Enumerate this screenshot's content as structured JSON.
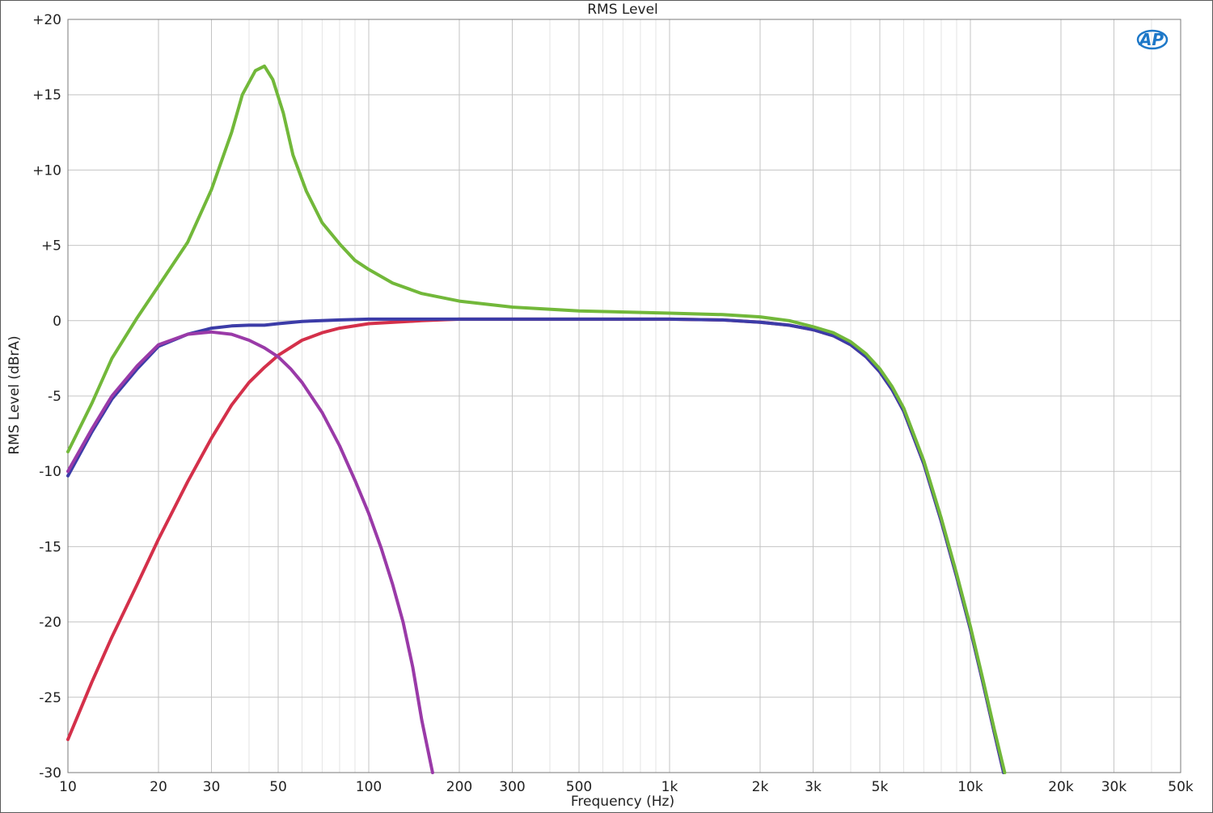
{
  "chart_data": {
    "type": "line",
    "title": "RMS Level",
    "xlabel": "Frequency (Hz)",
    "ylabel": "RMS Level (dBrA)",
    "x_scale": "log",
    "xlim": [
      10,
      50000
    ],
    "ylim": [
      -30,
      20
    ],
    "grid": true,
    "x_tick_values": [
      10,
      20,
      30,
      50,
      100,
      200,
      300,
      500,
      1000,
      2000,
      3000,
      5000,
      10000,
      20000,
      30000,
      50000
    ],
    "x_tick_labels": [
      "10",
      "20",
      "30",
      "50",
      "100",
      "200",
      "300",
      "500",
      "1k",
      "2k",
      "3k",
      "5k",
      "10k",
      "20k",
      "30k",
      "50k"
    ],
    "y_tick_values": [
      20,
      15,
      10,
      5,
      0,
      -5,
      -10,
      -15,
      -20,
      -25,
      -30
    ],
    "y_tick_labels": [
      "+20",
      "+15",
      "+10",
      "+5",
      "0",
      "-5",
      "-10",
      "-15",
      "-20",
      "-25",
      "-30"
    ],
    "logo_text": "AP",
    "series": [
      {
        "color": "#d4304a",
        "points": [
          [
            10,
            -27.8
          ],
          [
            12,
            -24.0
          ],
          [
            14,
            -21.0
          ],
          [
            17,
            -17.5
          ],
          [
            20,
            -14.5
          ],
          [
            25,
            -10.7
          ],
          [
            30,
            -7.8
          ],
          [
            35,
            -5.6
          ],
          [
            40,
            -4.1
          ],
          [
            45,
            -3.1
          ],
          [
            50,
            -2.3
          ],
          [
            60,
            -1.3
          ],
          [
            70,
            -0.8
          ],
          [
            80,
            -0.5
          ],
          [
            100,
            -0.2
          ],
          [
            150,
            0.0
          ],
          [
            200,
            0.1
          ],
          [
            500,
            0.1
          ],
          [
            1000,
            0.1
          ],
          [
            1500,
            0.05
          ],
          [
            2000,
            -0.1
          ],
          [
            2500,
            -0.3
          ],
          [
            3000,
            -0.6
          ],
          [
            3500,
            -1.0
          ],
          [
            4000,
            -1.6
          ],
          [
            4500,
            -2.4
          ],
          [
            5000,
            -3.4
          ],
          [
            5500,
            -4.6
          ],
          [
            6000,
            -6.0
          ],
          [
            7000,
            -9.5
          ],
          [
            8000,
            -13.3
          ],
          [
            9000,
            -17.0
          ],
          [
            10000,
            -20.5
          ],
          [
            11000,
            -24.0
          ],
          [
            12000,
            -27.3
          ],
          [
            12900,
            -30.0
          ]
        ]
      },
      {
        "color": "#3c3ca8",
        "points": [
          [
            10,
            -10.3
          ],
          [
            12,
            -7.4
          ],
          [
            14,
            -5.2
          ],
          [
            17,
            -3.2
          ],
          [
            20,
            -1.7
          ],
          [
            25,
            -0.9
          ],
          [
            30,
            -0.5
          ],
          [
            35,
            -0.35
          ],
          [
            40,
            -0.3
          ],
          [
            45,
            -0.3
          ],
          [
            50,
            -0.2
          ],
          [
            60,
            -0.05
          ],
          [
            80,
            0.05
          ],
          [
            100,
            0.1
          ],
          [
            200,
            0.1
          ],
          [
            500,
            0.1
          ],
          [
            1000,
            0.1
          ],
          [
            1500,
            0.05
          ],
          [
            2000,
            -0.1
          ],
          [
            2500,
            -0.3
          ],
          [
            3000,
            -0.6
          ],
          [
            3500,
            -1.0
          ],
          [
            4000,
            -1.6
          ],
          [
            4500,
            -2.4
          ],
          [
            5000,
            -3.4
          ],
          [
            5500,
            -4.6
          ],
          [
            6000,
            -6.0
          ],
          [
            7000,
            -9.5
          ],
          [
            8000,
            -13.3
          ],
          [
            9000,
            -17.0
          ],
          [
            10000,
            -20.5
          ],
          [
            11000,
            -24.0
          ],
          [
            12000,
            -27.3
          ],
          [
            12900,
            -30.0
          ]
        ]
      },
      {
        "color": "#9a3aa8",
        "points": [
          [
            10,
            -10.0
          ],
          [
            12,
            -7.2
          ],
          [
            14,
            -5.0
          ],
          [
            17,
            -3.0
          ],
          [
            20,
            -1.6
          ],
          [
            25,
            -0.9
          ],
          [
            30,
            -0.75
          ],
          [
            35,
            -0.9
          ],
          [
            40,
            -1.3
          ],
          [
            45,
            -1.8
          ],
          [
            50,
            -2.4
          ],
          [
            55,
            -3.2
          ],
          [
            60,
            -4.1
          ],
          [
            70,
            -6.1
          ],
          [
            80,
            -8.3
          ],
          [
            90,
            -10.6
          ],
          [
            100,
            -12.8
          ],
          [
            110,
            -15.1
          ],
          [
            120,
            -17.5
          ],
          [
            130,
            -20.0
          ],
          [
            140,
            -23.0
          ],
          [
            150,
            -26.5
          ],
          [
            163,
            -30.0
          ]
        ]
      },
      {
        "color": "#72b83a",
        "points": [
          [
            10,
            -8.7
          ],
          [
            12,
            -5.5
          ],
          [
            14,
            -2.5
          ],
          [
            17,
            0.2
          ],
          [
            20,
            2.3
          ],
          [
            25,
            5.2
          ],
          [
            30,
            8.7
          ],
          [
            35,
            12.5
          ],
          [
            38,
            15.0
          ],
          [
            42,
            16.6
          ],
          [
            45,
            16.9
          ],
          [
            48,
            16.0
          ],
          [
            52,
            13.8
          ],
          [
            56,
            11.0
          ],
          [
            62,
            8.6
          ],
          [
            70,
            6.5
          ],
          [
            80,
            5.1
          ],
          [
            90,
            4.0
          ],
          [
            100,
            3.4
          ],
          [
            120,
            2.5
          ],
          [
            150,
            1.8
          ],
          [
            200,
            1.3
          ],
          [
            300,
            0.9
          ],
          [
            500,
            0.65
          ],
          [
            1000,
            0.5
          ],
          [
            1500,
            0.4
          ],
          [
            2000,
            0.25
          ],
          [
            2500,
            0.0
          ],
          [
            3000,
            -0.4
          ],
          [
            3500,
            -0.8
          ],
          [
            4000,
            -1.4
          ],
          [
            4500,
            -2.2
          ],
          [
            5000,
            -3.2
          ],
          [
            5500,
            -4.4
          ],
          [
            6000,
            -5.8
          ],
          [
            7000,
            -9.3
          ],
          [
            8000,
            -13.1
          ],
          [
            9000,
            -16.8
          ],
          [
            10000,
            -20.3
          ],
          [
            11000,
            -23.8
          ],
          [
            12000,
            -27.1
          ],
          [
            13000,
            -30.0
          ]
        ]
      }
    ]
  }
}
